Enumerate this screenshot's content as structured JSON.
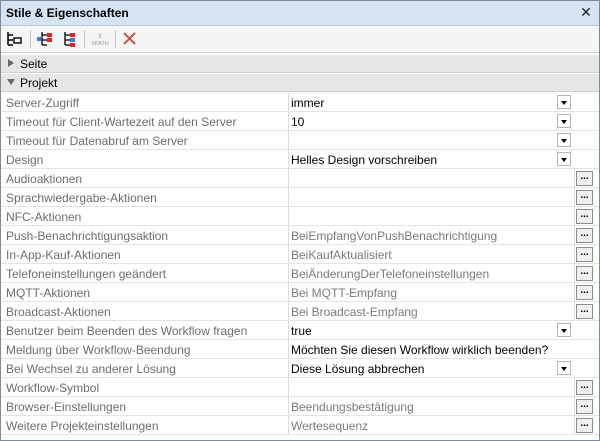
{
  "panel": {
    "title": "Stile & Eigenschaften",
    "close_glyph": "✕"
  },
  "toolbar": {
    "buttons": [
      {
        "name": "list-view-icon"
      },
      {
        "name": "add-property-icon"
      },
      {
        "name": "remove-property-icon"
      },
      {
        "name": "xpath-icon",
        "label": "XPATH"
      },
      {
        "name": "delete-icon"
      }
    ]
  },
  "sections": {
    "seite": "Seite",
    "projekt": "Projekt"
  },
  "properties": [
    {
      "label": "Server-Zugriff",
      "value": "immer",
      "control": "dropdown",
      "value_style": "set"
    },
    {
      "label": "Timeout für Client-Wartezeit auf den Server",
      "value": "10",
      "control": "dropdown",
      "value_style": "set"
    },
    {
      "label": "Timeout für Datenabruf am Server",
      "value": "",
      "control": "dropdown",
      "value_style": "set"
    },
    {
      "label": "Design",
      "value": "Helles Design vorschreiben",
      "control": "dropdown",
      "value_style": "set"
    },
    {
      "label": "Audioaktionen",
      "value": "",
      "control": "dialog",
      "value_style": "dim"
    },
    {
      "label": "Sprachwiedergabe-Aktionen",
      "value": "",
      "control": "dialog",
      "value_style": "dim"
    },
    {
      "label": "NFC-Aktionen",
      "value": "",
      "control": "dialog",
      "value_style": "dim"
    },
    {
      "label": "Push-Benachrichtigungsaktion",
      "value": "BeiEmpfangVonPushBenachrichtigung",
      "control": "dialog",
      "value_style": "dim"
    },
    {
      "label": "In-App-Kauf-Aktionen",
      "value": "BeiKaufAktualisiert",
      "control": "dialog",
      "value_style": "dim"
    },
    {
      "label": "Telefoneinstellungen geändert",
      "value": "BeiÄnderungDerTelefoneinstellungen",
      "control": "dialog",
      "value_style": "dim"
    },
    {
      "label": "MQTT-Aktionen",
      "value": "Bei MQTT-Empfang",
      "control": "dialog",
      "value_style": "dim"
    },
    {
      "label": "Broadcast-Aktionen",
      "value": "Bei Broadcast-Empfang",
      "control": "dialog",
      "value_style": "dim"
    },
    {
      "label": "Benutzer beim Beenden des Workflow fragen",
      "value": "true",
      "control": "dropdown",
      "value_style": "set"
    },
    {
      "label": "Meldung über Workflow-Beendung",
      "value": "Möchten Sie diesen Workflow wirklich beenden?",
      "control": "none",
      "value_style": "set"
    },
    {
      "label": "Bei Wechsel zu anderer Lösung",
      "value": "Diese Lösung abbrechen",
      "control": "dropdown",
      "value_style": "set"
    },
    {
      "label": "Workflow-Symbol",
      "value": "",
      "control": "dialog",
      "value_style": "dim"
    },
    {
      "label": "Browser-Einstellungen",
      "value": "Beendungsbestätigung",
      "control": "dialog",
      "value_style": "dim"
    },
    {
      "label": "Weitere Projekteinstellungen",
      "value": "Wertesequenz",
      "control": "dialog",
      "value_style": "dim"
    }
  ],
  "dialog_button_label": "..."
}
